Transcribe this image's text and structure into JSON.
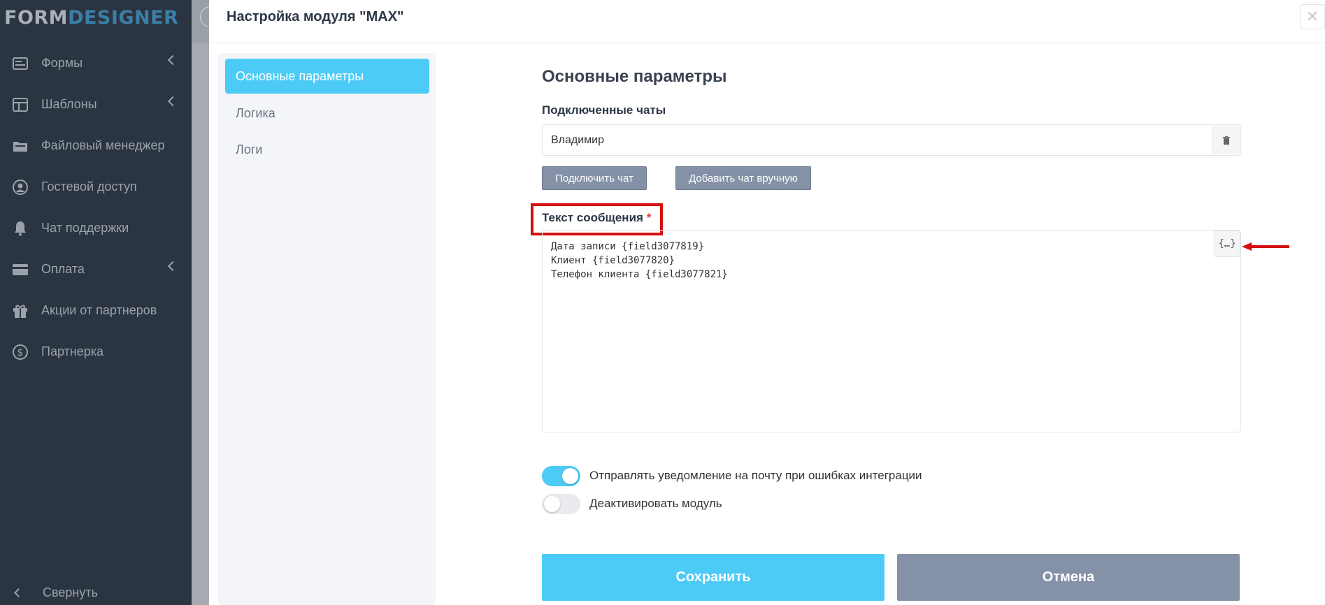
{
  "logo": {
    "part1": "FORM",
    "part2": "DESIGNER"
  },
  "sidebar": {
    "items": [
      {
        "label": "Формы",
        "icon": "forms-icon",
        "has_chevron": true
      },
      {
        "label": "Шаблоны",
        "icon": "templates-icon",
        "has_chevron": true
      },
      {
        "label": "Файловый менеджер",
        "icon": "folder-icon",
        "has_chevron": false
      },
      {
        "label": "Гостевой доступ",
        "icon": "user-icon",
        "has_chevron": false
      },
      {
        "label": "Чат поддержки",
        "icon": "bell-icon",
        "has_chevron": false
      },
      {
        "label": "Оплата",
        "icon": "card-icon",
        "has_chevron": true
      },
      {
        "label": "Акции от партнеров",
        "icon": "gift-icon",
        "has_chevron": false
      },
      {
        "label": "Партнерка",
        "icon": "dollar-icon",
        "has_chevron": false
      }
    ],
    "collapse_label": "Свернуть"
  },
  "modal": {
    "title": "Настройка модуля \"MAX\"",
    "close": "✕",
    "tabs": [
      {
        "label": "Основные параметры",
        "active": true
      },
      {
        "label": "Логика",
        "active": false
      },
      {
        "label": "Логи",
        "active": false
      }
    ],
    "section_title": "Основные параметры",
    "chats_label": "Подключенные чаты",
    "chat_value": "Владимир",
    "connect_chat_label": "Подключить чат",
    "add_chat_label": "Добавить чат вручную",
    "message_label": "Текст сообщения",
    "required_mark": "*",
    "message_text": "Дата записи {field3077819}\nКлиент {field3077820}\nТелефон клиента {field3077821}",
    "var_button": "{…}",
    "notify_toggle": {
      "label": "Отправлять уведомление на почту при ошибках интеграции",
      "on": true
    },
    "deactivate_toggle": {
      "label": "Деактивировать модуль",
      "on": false
    },
    "save_label": "Сохранить",
    "cancel_label": "Отмена"
  },
  "colors": {
    "accent": "#4ccbf7",
    "sidebar_bg": "#2b3441",
    "secondary_btn": "#8591a6",
    "highlight": "#d4100f"
  }
}
